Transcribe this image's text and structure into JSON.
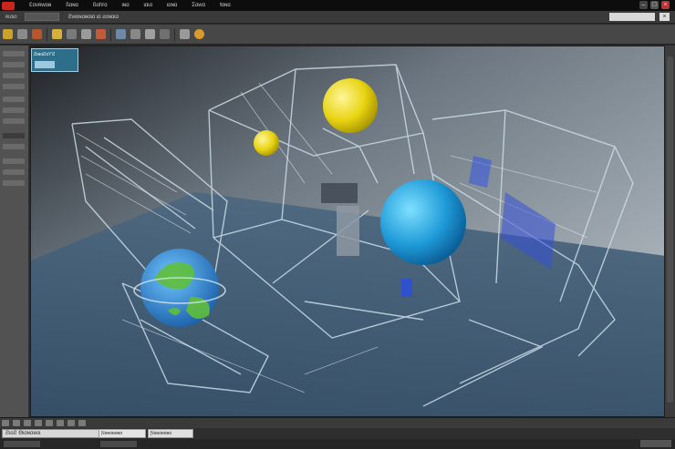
{
  "menubar": {
    "items": [
      "Ɛɑvʀwɑɵ",
      "ßɑɴɑ",
      "ßɑhŀɑ",
      "ɩɴɑ",
      "ɩɑɩɑ",
      "ɩɑɴɑ",
      "Ʃɑwɑ",
      "ɬɑɴɑ"
    ]
  },
  "subbar": {
    "label": "ʀɩɑɩɑ",
    "title": "Ƨwɑɴɑɵɑɩɑ ɩɑ ƨɑɴɑɩɑ"
  },
  "overlay": {
    "badge_text": "ƧɩɴɑƧɑƳƧ"
  },
  "status": {
    "left_text": "ƧɩɑƧ Ɵɩɑɴɑɵɑɩ",
    "mid_text": "Ɲɑɴɑɴɑɴɑ",
    "right_text": "Ɲɑɴɑɴɑɵɑ"
  },
  "colors": {
    "accent": "#c8261d",
    "viewport_bg": "#6f8494",
    "floor": "#3f5d78"
  }
}
